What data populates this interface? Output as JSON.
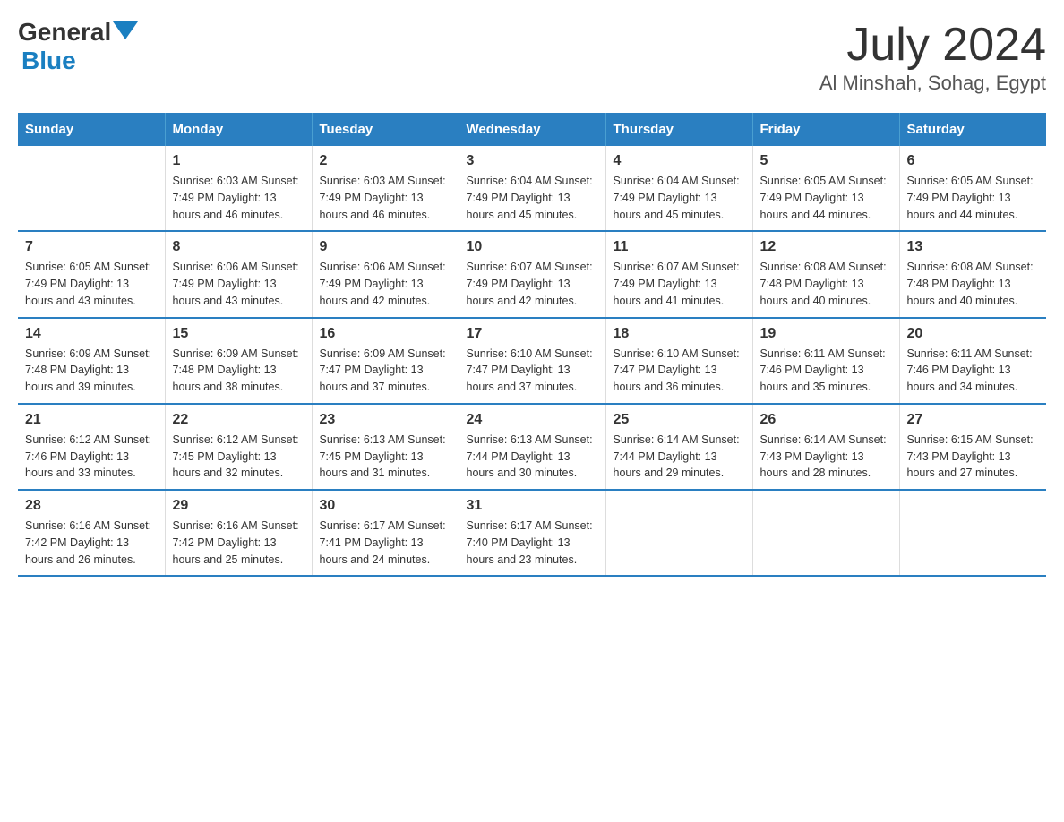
{
  "header": {
    "logo_general": "General",
    "logo_blue": "Blue",
    "month_title": "July 2024",
    "location": "Al Minshah, Sohag, Egypt"
  },
  "days_of_week": [
    "Sunday",
    "Monday",
    "Tuesday",
    "Wednesday",
    "Thursday",
    "Friday",
    "Saturday"
  ],
  "weeks": [
    [
      {
        "day": "",
        "info": ""
      },
      {
        "day": "1",
        "info": "Sunrise: 6:03 AM\nSunset: 7:49 PM\nDaylight: 13 hours\nand 46 minutes."
      },
      {
        "day": "2",
        "info": "Sunrise: 6:03 AM\nSunset: 7:49 PM\nDaylight: 13 hours\nand 46 minutes."
      },
      {
        "day": "3",
        "info": "Sunrise: 6:04 AM\nSunset: 7:49 PM\nDaylight: 13 hours\nand 45 minutes."
      },
      {
        "day": "4",
        "info": "Sunrise: 6:04 AM\nSunset: 7:49 PM\nDaylight: 13 hours\nand 45 minutes."
      },
      {
        "day": "5",
        "info": "Sunrise: 6:05 AM\nSunset: 7:49 PM\nDaylight: 13 hours\nand 44 minutes."
      },
      {
        "day": "6",
        "info": "Sunrise: 6:05 AM\nSunset: 7:49 PM\nDaylight: 13 hours\nand 44 minutes."
      }
    ],
    [
      {
        "day": "7",
        "info": "Sunrise: 6:05 AM\nSunset: 7:49 PM\nDaylight: 13 hours\nand 43 minutes."
      },
      {
        "day": "8",
        "info": "Sunrise: 6:06 AM\nSunset: 7:49 PM\nDaylight: 13 hours\nand 43 minutes."
      },
      {
        "day": "9",
        "info": "Sunrise: 6:06 AM\nSunset: 7:49 PM\nDaylight: 13 hours\nand 42 minutes."
      },
      {
        "day": "10",
        "info": "Sunrise: 6:07 AM\nSunset: 7:49 PM\nDaylight: 13 hours\nand 42 minutes."
      },
      {
        "day": "11",
        "info": "Sunrise: 6:07 AM\nSunset: 7:49 PM\nDaylight: 13 hours\nand 41 minutes."
      },
      {
        "day": "12",
        "info": "Sunrise: 6:08 AM\nSunset: 7:48 PM\nDaylight: 13 hours\nand 40 minutes."
      },
      {
        "day": "13",
        "info": "Sunrise: 6:08 AM\nSunset: 7:48 PM\nDaylight: 13 hours\nand 40 minutes."
      }
    ],
    [
      {
        "day": "14",
        "info": "Sunrise: 6:09 AM\nSunset: 7:48 PM\nDaylight: 13 hours\nand 39 minutes."
      },
      {
        "day": "15",
        "info": "Sunrise: 6:09 AM\nSunset: 7:48 PM\nDaylight: 13 hours\nand 38 minutes."
      },
      {
        "day": "16",
        "info": "Sunrise: 6:09 AM\nSunset: 7:47 PM\nDaylight: 13 hours\nand 37 minutes."
      },
      {
        "day": "17",
        "info": "Sunrise: 6:10 AM\nSunset: 7:47 PM\nDaylight: 13 hours\nand 37 minutes."
      },
      {
        "day": "18",
        "info": "Sunrise: 6:10 AM\nSunset: 7:47 PM\nDaylight: 13 hours\nand 36 minutes."
      },
      {
        "day": "19",
        "info": "Sunrise: 6:11 AM\nSunset: 7:46 PM\nDaylight: 13 hours\nand 35 minutes."
      },
      {
        "day": "20",
        "info": "Sunrise: 6:11 AM\nSunset: 7:46 PM\nDaylight: 13 hours\nand 34 minutes."
      }
    ],
    [
      {
        "day": "21",
        "info": "Sunrise: 6:12 AM\nSunset: 7:46 PM\nDaylight: 13 hours\nand 33 minutes."
      },
      {
        "day": "22",
        "info": "Sunrise: 6:12 AM\nSunset: 7:45 PM\nDaylight: 13 hours\nand 32 minutes."
      },
      {
        "day": "23",
        "info": "Sunrise: 6:13 AM\nSunset: 7:45 PM\nDaylight: 13 hours\nand 31 minutes."
      },
      {
        "day": "24",
        "info": "Sunrise: 6:13 AM\nSunset: 7:44 PM\nDaylight: 13 hours\nand 30 minutes."
      },
      {
        "day": "25",
        "info": "Sunrise: 6:14 AM\nSunset: 7:44 PM\nDaylight: 13 hours\nand 29 minutes."
      },
      {
        "day": "26",
        "info": "Sunrise: 6:14 AM\nSunset: 7:43 PM\nDaylight: 13 hours\nand 28 minutes."
      },
      {
        "day": "27",
        "info": "Sunrise: 6:15 AM\nSunset: 7:43 PM\nDaylight: 13 hours\nand 27 minutes."
      }
    ],
    [
      {
        "day": "28",
        "info": "Sunrise: 6:16 AM\nSunset: 7:42 PM\nDaylight: 13 hours\nand 26 minutes."
      },
      {
        "day": "29",
        "info": "Sunrise: 6:16 AM\nSunset: 7:42 PM\nDaylight: 13 hours\nand 25 minutes."
      },
      {
        "day": "30",
        "info": "Sunrise: 6:17 AM\nSunset: 7:41 PM\nDaylight: 13 hours\nand 24 minutes."
      },
      {
        "day": "31",
        "info": "Sunrise: 6:17 AM\nSunset: 7:40 PM\nDaylight: 13 hours\nand 23 minutes."
      },
      {
        "day": "",
        "info": ""
      },
      {
        "day": "",
        "info": ""
      },
      {
        "day": "",
        "info": ""
      }
    ]
  ]
}
